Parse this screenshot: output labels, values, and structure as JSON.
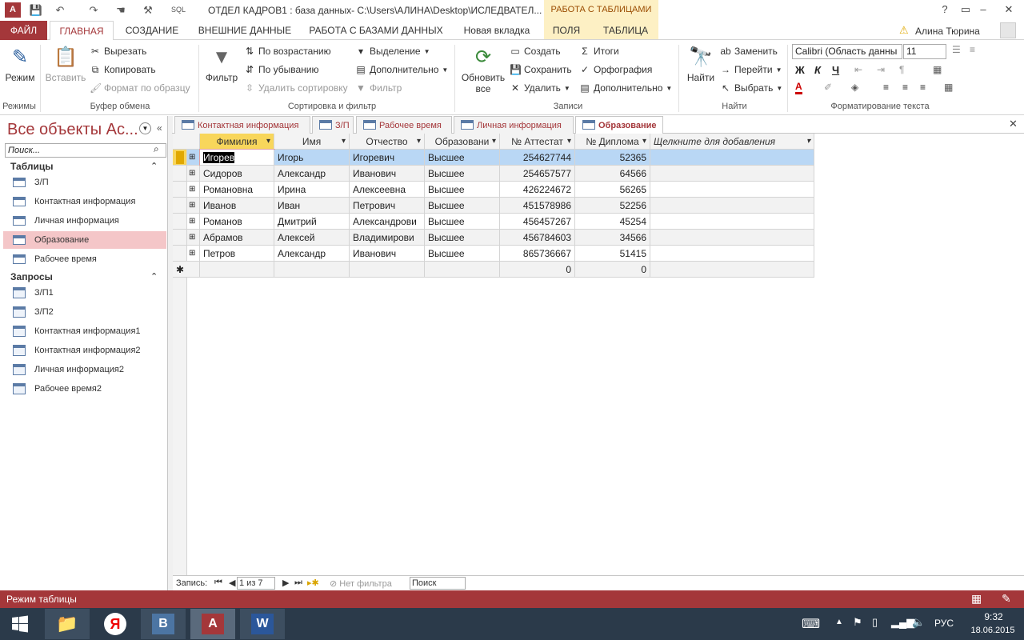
{
  "app_icon": "A",
  "qat": {
    "sql": "SQL"
  },
  "window_title": "ОТДЕЛ КАДРОВ1 : база данных- C:\\Users\\АЛИНА\\Desktop\\ИСЛЕДВАТЕЛ...",
  "context_tab_title": "РАБОТА С ТАБЛИЦАМИ",
  "ribbon_tabs": [
    "ФАЙЛ",
    "ГЛАВНАЯ",
    "СОЗДАНИЕ",
    "ВНЕШНИЕ ДАННЫЕ",
    "РАБОТА С БАЗАМИ ДАННЫХ",
    "Новая вкладка",
    "ПОЛЯ",
    "ТАБЛИЦА"
  ],
  "user": "Алина Тюрина",
  "ribbon": {
    "mode": {
      "label": "Режим",
      "group": "Режимы"
    },
    "clipboard": {
      "paste": "Вставить",
      "cut": "Вырезать",
      "copy": "Копировать",
      "format_painter": "Формат по образцу",
      "group": "Буфер обмена"
    },
    "sort": {
      "filter": "Фильтр",
      "asc": "По возрастанию",
      "desc": "По убыванию",
      "remove_sort": "Удалить сортировку",
      "selection": "Выделение",
      "advanced": "Дополнительно",
      "toggle_filter": "Фильтр",
      "group": "Сортировка и фильтр"
    },
    "records": {
      "refresh": "Обновить",
      "refresh2": "все",
      "new": "Создать",
      "save": "Сохранить",
      "delete": "Удалить",
      "totals": "Итоги",
      "spelling": "Орфография",
      "more": "Дополнительно",
      "group": "Записи"
    },
    "find": {
      "find": "Найти",
      "replace": "Заменить",
      "goto": "Перейти",
      "select": "Выбрать",
      "group": "Найти"
    },
    "text": {
      "font": "Calibri (Область данны",
      "size": "11",
      "bold": "Ж",
      "italic": "К",
      "underline": "Ч",
      "group": "Форматирование текста"
    }
  },
  "nav": {
    "title": "Все объекты Ac...",
    "search_placeholder": "Поиск...",
    "tables_header": "Таблицы",
    "tables": [
      "З/П",
      "Контактная информация",
      "Личная информация",
      "Образование",
      "Рабочее время"
    ],
    "queries_header": "Запросы",
    "queries": [
      "З/П1",
      "З/П2",
      "Контактная информация1",
      "Контактная информация2",
      "Личная информация2",
      "Рабочее время2"
    ]
  },
  "doc_tabs": [
    "Контактная информация",
    "З/П",
    "Рабочее время",
    "Личная информация",
    "Образование"
  ],
  "grid": {
    "columns": [
      "Фимилия",
      "Имя",
      "Отчество",
      "Образовани",
      "№ Аттестат",
      "№ Диплома",
      "Щелкните для добавления"
    ],
    "rows": [
      [
        "Игорев",
        "Игорь",
        "Игоревич",
        "Высшее",
        "254627744",
        "52365"
      ],
      [
        "Сидоров",
        "Александр",
        "Иванович",
        "Высшее",
        "254657577",
        "64566"
      ],
      [
        "Романовна",
        "Ирина",
        "Алексеевна",
        "Высшее",
        "426224672",
        "56265"
      ],
      [
        "Иванов",
        "Иван",
        "Петрович",
        "Высшее",
        "451578986",
        "52256"
      ],
      [
        "Романов",
        "Дмитрий",
        "Александрови",
        "Высшее",
        "456457267",
        "45254"
      ],
      [
        "Абрамов",
        "Алексей",
        "Владимирови",
        "Высшее",
        "456784603",
        "34566"
      ],
      [
        "Петров",
        "Александр",
        "Иванович",
        "Высшее",
        "865736667",
        "51415"
      ]
    ],
    "new_row": [
      "",
      "",
      "",
      "",
      "0",
      "0"
    ],
    "new_row_marker": "✱"
  },
  "record_nav": {
    "label": "Запись:",
    "position": "1 из 7",
    "filter": "Нет фильтра",
    "search": "Поиск"
  },
  "status": "Режим таблицы",
  "taskbar": {
    "lang": "РУС",
    "time": "9:32",
    "date": "18.06.2015"
  },
  "colors": {
    "accent": "#a4373a",
    "selected_row": "#b9d7f5",
    "header_active": "#f8d65b"
  }
}
